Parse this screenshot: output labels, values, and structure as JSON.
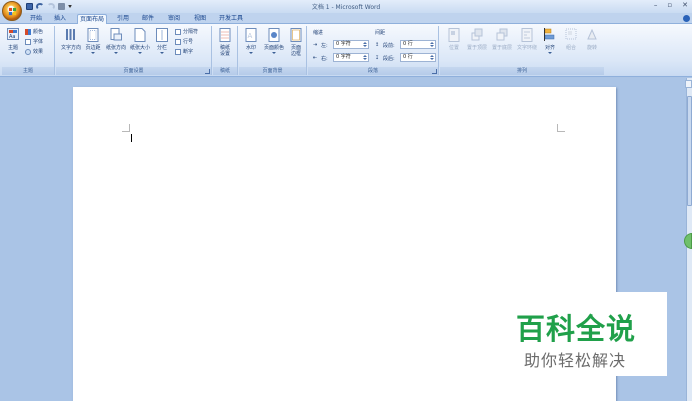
{
  "window": {
    "title": "文档 1 - Microsoft Word",
    "controls": [
      "–",
      "▫",
      "✕"
    ]
  },
  "tabs": [
    {
      "label": "开始",
      "active": false
    },
    {
      "label": "插入",
      "active": false
    },
    {
      "label": "页面布局",
      "active": true
    },
    {
      "label": "引用",
      "active": false
    },
    {
      "label": "邮件",
      "active": false
    },
    {
      "label": "审阅",
      "active": false
    },
    {
      "label": "视图",
      "active": false
    },
    {
      "label": "开发工具",
      "active": false
    }
  ],
  "ribbon": {
    "theme": {
      "label": "主题",
      "main": "主题",
      "colors": "颜色",
      "fonts": "字体",
      "effects": "效果"
    },
    "page_setup": {
      "label": "页面设置",
      "buttons": [
        "文字方向",
        "页边距",
        "纸张方向",
        "纸张大小",
        "分栏"
      ],
      "breaks": "分隔符",
      "line_numbers": "行号",
      "hyphenation": "断字"
    },
    "draft": {
      "label": "稿纸",
      "button": "稿纸\n设置"
    },
    "page_background": {
      "label": "页面背景",
      "watermark": "水印",
      "page_color": "页面颜色",
      "page_borders": "页面\n边框"
    },
    "paragraph": {
      "label": "段落",
      "indent_label": "缩进",
      "spacing_label": "间距",
      "left_label": "左:",
      "left_value": "0 字符",
      "right_label": "右:",
      "right_value": "0 字符",
      "before_label": "段前:",
      "before_value": "0 行",
      "after_label": "段后:",
      "after_value": "0 行"
    },
    "arrange": {
      "label": "排列",
      "buttons": [
        "位置",
        "置于顶层",
        "置于底层",
        "文字环绕",
        "对齐",
        "组合",
        "旋转"
      ]
    }
  },
  "watermark_overlay": {
    "title": "百科全说",
    "subtitle": "助你轻松解决"
  },
  "colors": {
    "ribbon_blue": "#15428b",
    "watermark_green": "#20a04a"
  }
}
